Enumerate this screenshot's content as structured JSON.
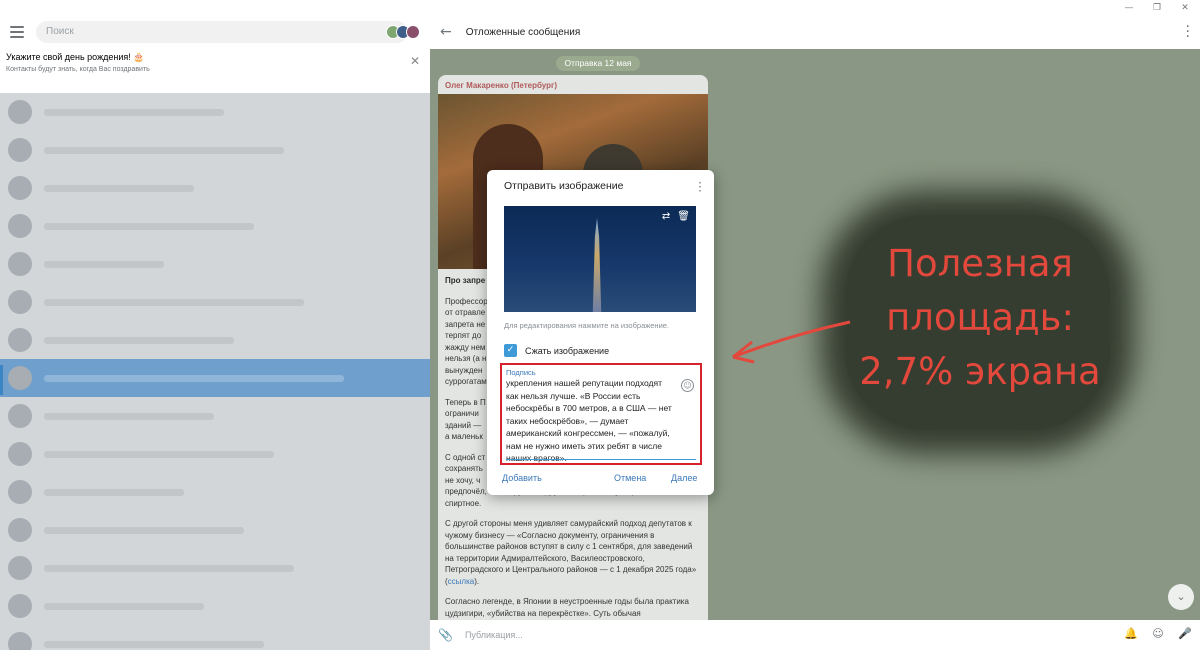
{
  "search": {
    "placeholder": "Поиск"
  },
  "banner": {
    "title": "Укажите свой день рождения! 🎂",
    "subtitle": "Контакты будут знать, когда Вас поздравить"
  },
  "chat": {
    "title": "Отложенные сообщения",
    "date_pill": "Отправка 12 мая",
    "composer_placeholder": "Публикация..."
  },
  "message": {
    "author": "Олег Макаренко (Петербург)",
    "lead": "Про запре",
    "paragraphs": [
      "Профессор",
      "от отравле",
      "запрета не",
      "терпят до",
      "жажду нем",
      "нельзя (а н",
      "вынужден",
      "суррогатам",
      "Теперь в П",
      "ограничи",
      "зданий —",
      "а маленьк",
      "С одной ст",
      "сохранять",
      "не хочу, ч",
      "предпочёл, чтобы русские дружно перестали употреблять",
      "спиртное."
    ],
    "p_samurai": "С другой стороны меня удивляет самурайский подход депутатов к чужому бизнесу — «Согласно документу, ограничения в большинстве районов вступят в силу с 1 сентября, для заведений на территории Адмиралтейского, Василеостровского, Петроградского и Центрального районов — с 1 декабря 2025 года» (",
    "p_samurai_link": "ссылка",
    "p_samurai_end": ").",
    "p_legend": "Согласно легенде, в Японии в неустроенные годы была практика цудзигири, «убийства на перекрёстке». Суть обычая"
  },
  "modal": {
    "title": "Отправить изображение",
    "hint": "Для редактирования нажмите на изображение.",
    "compress_label": "Сжать изображение",
    "caption_label": "Подпись",
    "caption_text": "укрепления нашей репутации подходят как нельзя лучше. «В России есть небоскрёбы в 700 метров, а в США — нет таких небоскрёбов», — думает американский конгрессмен, — «пожалуй, нам не нужно иметь этих ребят в числе наших врагов».",
    "add_button": "Добавить",
    "cancel_button": "Отмена",
    "next_button": "Далее"
  },
  "annotation": {
    "lines": [
      "Полезная",
      "площадь:",
      "2,7% экрана"
    ],
    "color": "#e2483c"
  },
  "colors": {
    "accent": "#3a78b8",
    "checkbox": "#3f9ad8",
    "highlight_border": "#d6232b",
    "chat_bg": "#8a9784"
  },
  "icons": {
    "menu": "hamburger-icon",
    "back": "back-arrow-icon",
    "more": "more-vertical-icon",
    "attach": "paperclip-icon",
    "bell": "bell-icon",
    "emoji": "emoji-icon",
    "mic": "microphone-icon"
  }
}
